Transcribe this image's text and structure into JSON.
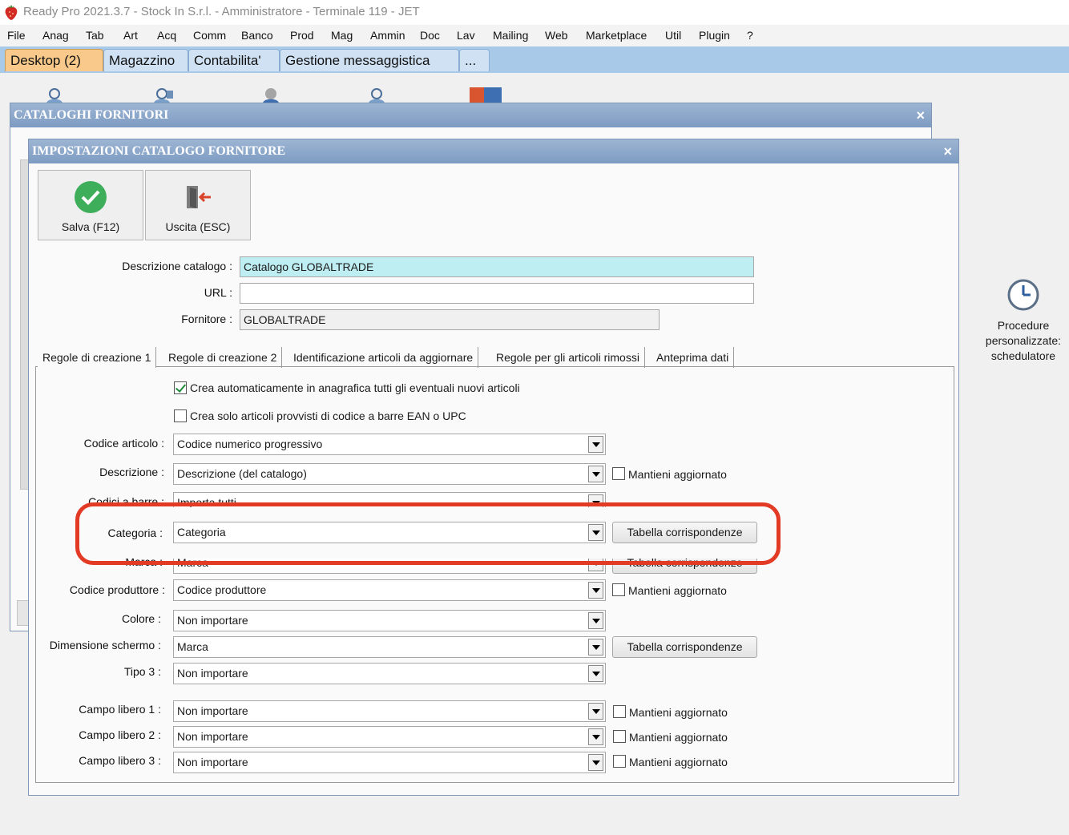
{
  "window": {
    "title": "Ready Pro 2021.3.7 - Stock In S.r.l. - Amministratore - Terminale 119 - JET"
  },
  "menu": [
    "File",
    "Anag",
    "Tab",
    "Art",
    "Acq",
    "Comm",
    "Banco",
    "Prod",
    "Mag",
    "Ammin",
    "Doc",
    "Lav",
    "Mailing",
    "Web",
    "Marketplace",
    "Util",
    "Plugin",
    "?"
  ],
  "tabs": [
    "Desktop (2)",
    "Magazzino",
    "Contabilita'",
    "Gestione messaggistica",
    "..."
  ],
  "back_window": {
    "title": "CATALOGHI FORNITORI",
    "close": "×"
  },
  "dialog": {
    "title": "IMPOSTAZIONI CATALOGO FORNITORE",
    "close": "×",
    "save_label": "Salva (F12)",
    "exit_label": "Uscita (ESC)",
    "descrizione_label": "Descrizione catalogo :",
    "descrizione_value": "Catalogo GLOBALTRADE",
    "url_label": "URL :",
    "url_value": "",
    "fornitore_label": "Fornitore :",
    "fornitore_value": "GLOBALTRADE",
    "tabs": [
      "Regole di creazione 1",
      "Regole di creazione 2",
      "Identificazione articoli da aggiornare",
      "Regole per gli articoli rimossi",
      "Anteprima dati"
    ],
    "check_crea_auto": "Crea automaticamente in anagrafica tutti gli eventuali nuovi articoli",
    "check_crea_ean": "Crea solo articoli provvisti di codice a barre EAN o UPC",
    "rows": {
      "codice_articolo": {
        "label": "Codice articolo :",
        "value": "Codice numerico progressivo"
      },
      "descrizione": {
        "label": "Descrizione :",
        "value": "Descrizione (del catalogo)",
        "check": "Mantieni aggiornato"
      },
      "codici_barre": {
        "label": "Codici a barre :",
        "value": "Importa tutti"
      },
      "categoria": {
        "label": "Categoria :",
        "value": "Categoria",
        "button": "Tabella corrispondenze"
      },
      "marca": {
        "label": "Marca :",
        "value": "Marca",
        "button": "Tabella corrispondenze"
      },
      "codice_produttore": {
        "label": "Codice produttore :",
        "value": "Codice produttore",
        "check": "Mantieni aggiornato"
      },
      "colore": {
        "label": "Colore :",
        "value": "Non importare"
      },
      "dimensione": {
        "label": "Dimensione schermo :",
        "value": "Marca",
        "button": "Tabella corrispondenze"
      },
      "tipo3": {
        "label": "Tipo 3 :",
        "value": "Non importare"
      },
      "campo1": {
        "label": "Campo libero 1 :",
        "value": "Non importare",
        "check": "Mantieni aggiornato"
      },
      "campo2": {
        "label": "Campo libero 2 :",
        "value": "Non importare",
        "check": "Mantieni aggiornato"
      },
      "campo3": {
        "label": "Campo libero 3 :",
        "value": "Non importare",
        "check": "Mantieni aggiornato"
      }
    }
  },
  "scheduler": {
    "line1": "Procedure",
    "line2": "personalizzate:",
    "line3": "schedulatore"
  }
}
